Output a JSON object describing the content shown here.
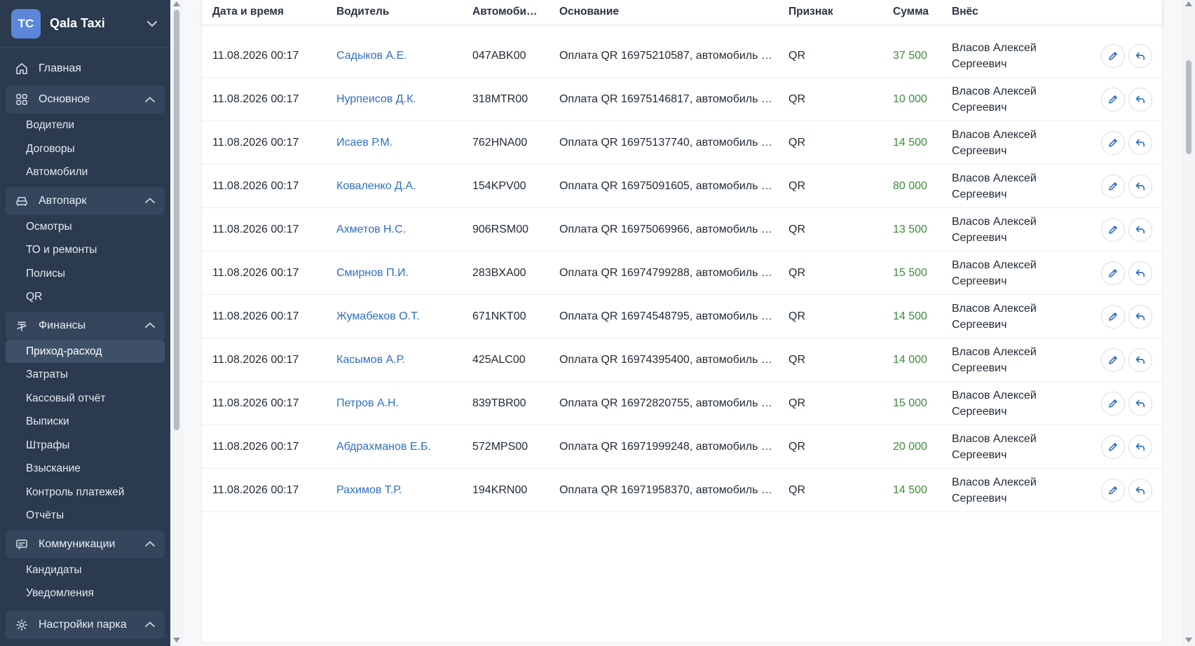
{
  "app": {
    "badge": "TC",
    "name": "Qala Taxi"
  },
  "sidebar": {
    "home": "Главная",
    "groups": [
      {
        "label": "Основное",
        "items": [
          "Водители",
          "Договоры",
          "Автомобили"
        ]
      },
      {
        "label": "Автопарк",
        "items": [
          "Осмотры",
          "ТО и ремонты",
          "Полисы",
          "QR"
        ]
      },
      {
        "label": "Финансы",
        "items": [
          "Приход-расход",
          "Затраты",
          "Кассовый отчёт",
          "Выписки",
          "Штрафы",
          "Взыскание",
          "Контроль платежей",
          "Отчёты"
        ]
      },
      {
        "label": "Коммуникации",
        "items": [
          "Кандидаты",
          "Уведомления"
        ]
      },
      {
        "label": "Настройки парка",
        "items": []
      }
    ],
    "active_item": "Приход-расход"
  },
  "table": {
    "headers": [
      "Дата и время",
      "Водитель",
      "Автомоби…",
      "Основание",
      "Признак",
      "Сумма",
      "Внёс"
    ],
    "rows": [
      {
        "date": "11.08.2026 00:17",
        "driver": "Садыков А.Е.",
        "car": "047ABK00",
        "reason": "Оплата QR 16975210587, автомобиль …",
        "sign": "QR",
        "sum": "37 500",
        "author1": "Власов Алексей",
        "author2": "Сергеевич"
      },
      {
        "date": "11.08.2026 00:17",
        "driver": "Нурпеисов Д.К.",
        "car": "318MTR00",
        "reason": "Оплата QR 16975146817, автомобиль …",
        "sign": "QR",
        "sum": "10 000",
        "author1": "Власов Алексей",
        "author2": "Сергеевич"
      },
      {
        "date": "11.08.2026 00:17",
        "driver": "Исаев Р.М.",
        "car": "762HNA00",
        "reason": "Оплата QR 16975137740, автомобиль …",
        "sign": "QR",
        "sum": "14 500",
        "author1": "Власов Алексей",
        "author2": "Сергеевич"
      },
      {
        "date": "11.08.2026 00:17",
        "driver": "Коваленко Д.А.",
        "car": "154KPV00",
        "reason": "Оплата QR 16975091605, автомобиль …",
        "sign": "QR",
        "sum": "80 000",
        "author1": "Власов Алексей",
        "author2": "Сергеевич"
      },
      {
        "date": "11.08.2026 00:17",
        "driver": "Ахметов Н.С.",
        "car": "906RSM00",
        "reason": "Оплата QR 16975069966, автомобиль …",
        "sign": "QR",
        "sum": "13 500",
        "author1": "Власов Алексей",
        "author2": "Сергеевич"
      },
      {
        "date": "11.08.2026 00:17",
        "driver": "Смирнов П.И.",
        "car": "283BXA00",
        "reason": "Оплата QR 16974799288, автомобиль …",
        "sign": "QR",
        "sum": "15 500",
        "author1": "Власов Алексей",
        "author2": "Сергеевич"
      },
      {
        "date": "11.08.2026 00:17",
        "driver": "Жумабеков О.Т.",
        "car": "671NKT00",
        "reason": "Оплата QR 16974548795, автомобиль …",
        "sign": "QR",
        "sum": "14 500",
        "author1": "Власов Алексей",
        "author2": "Сергеевич"
      },
      {
        "date": "11.08.2026 00:17",
        "driver": "Касымов А.Р.",
        "car": "425ALC00",
        "reason": "Оплата QR 16974395400, автомобиль …",
        "sign": "QR",
        "sum": "14 000",
        "author1": "Власов Алексей",
        "author2": "Сергеевич"
      },
      {
        "date": "11.08.2026 00:17",
        "driver": "Петров А.Н.",
        "car": "839TBR00",
        "reason": "Оплата QR 16972820755, автомобиль …",
        "sign": "QR",
        "sum": "15 000",
        "author1": "Власов Алексей",
        "author2": "Сергеевич"
      },
      {
        "date": "11.08.2026 00:17",
        "driver": "Абдрахманов Е.Б.",
        "car": "572MPS00",
        "reason": "Оплата QR 16971999248, автомобиль …",
        "sign": "QR",
        "sum": "20 000",
        "author1": "Власов Алексей",
        "author2": "Сергеевич"
      },
      {
        "date": "11.08.2026 00:17",
        "driver": "Рахимов Т.Р.",
        "car": "194KRN00",
        "reason": "Оплата QR 16971958370, автомобиль …",
        "sign": "QR",
        "sum": "14 500",
        "author1": "Власов Алексей",
        "author2": "Сергеевич"
      }
    ]
  },
  "icons": {
    "home": "home-icon",
    "main": "grid-icon",
    "fleet": "car-icon",
    "finance": "currency-icon",
    "comms": "message-icon",
    "settings": "gear-icon",
    "edit": "pencil-icon",
    "revert": "undo-icon"
  },
  "colors": {
    "sidebar": "#2b3a4e",
    "accent": "#5b86d9",
    "link": "#2f6fc2",
    "sum": "#3f8b3a"
  }
}
